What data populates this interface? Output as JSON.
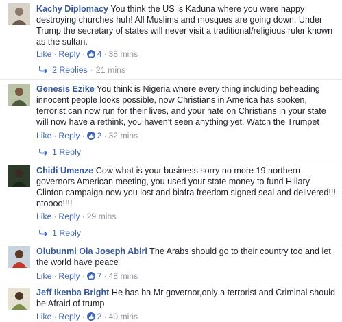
{
  "labels": {
    "like": "Like",
    "reply": "Reply",
    "dot": "·"
  },
  "comments": [
    {
      "author": "Kachy Diplomacy",
      "text": "You think the US is Kaduna where you were happy destroying churches huh! All Muslims and mosques are going down. Under Trump the secretary of states will never visit a traditional/religious ruler known as the sultan.",
      "likes": "4",
      "time": "38 mins",
      "replies_label": "2 Replies",
      "replies_time": "21 mins"
    },
    {
      "author": "Genesis Ezike",
      "text": "You think is Nigeria where every thing including beheading innocent people looks possible, now Christians in America has spoken, terrorist can now run for their lives, and your hate on Christians in your state will now have a rethink, you haven't seen anything yet. Watch the Trumpet",
      "likes": "2",
      "time": "32 mins",
      "replies_label": "1 Reply"
    },
    {
      "author": "Chidi Umenze",
      "text": "Cow what is your business sorry no more 19 northern governors American meeting, you used your state money to fund Hillary Clinton campaign now you lost and biafra freedom signed seal and delivered!!! ntoooo!!!!",
      "time": "29 mins",
      "replies_label": "1 Reply"
    },
    {
      "author": "Olubunmi Ola Joseph Abiri",
      "text": "The Arabs should go to their country too and let the world have peace",
      "likes": "7",
      "time": "48 mins"
    },
    {
      "author": "Jeff Ikenba Bright",
      "text": "He has ha Mr governor,only a terrorist and Criminal should be Afraid of trump",
      "likes": "2",
      "time": "49 mins"
    }
  ],
  "colors": {
    "link": "#4267b2",
    "author": "#365899",
    "meta": "#90949c",
    "text": "#1d2129"
  }
}
